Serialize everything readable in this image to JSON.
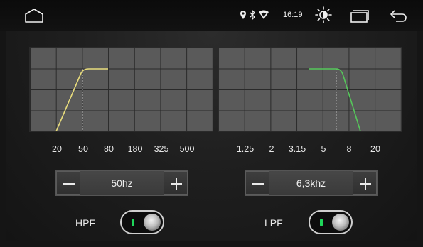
{
  "status_bar": {
    "time": "16:19",
    "icons": [
      "home-icon",
      "location-icon",
      "bluetooth-icon",
      "wifi-icon",
      "brightness-icon",
      "recent-apps-icon",
      "back-icon"
    ]
  },
  "hpf": {
    "graph": {
      "x_ticks": [
        "20",
        "50",
        "80",
        "180",
        "325",
        "500"
      ],
      "curve_color": "#e8dc7c",
      "cutoff_marker": "50"
    },
    "stepper": {
      "minus_label": "−",
      "value": "50hz",
      "plus_label": "+"
    },
    "label": "HPF",
    "enabled": true
  },
  "lpf": {
    "graph": {
      "x_ticks": [
        "1.25",
        "2",
        "3.15",
        "5",
        "8",
        "20"
      ],
      "curve_color": "#55c75a",
      "cutoff_marker": "5"
    },
    "stepper": {
      "minus_label": "−",
      "value": "6,3khz",
      "plus_label": "+"
    },
    "label": "LPF",
    "enabled": true
  },
  "colors": {
    "toggle_indicator": "#1fd65a",
    "hpf_curve": "#e8dc7c",
    "lpf_curve": "#55c75a"
  }
}
